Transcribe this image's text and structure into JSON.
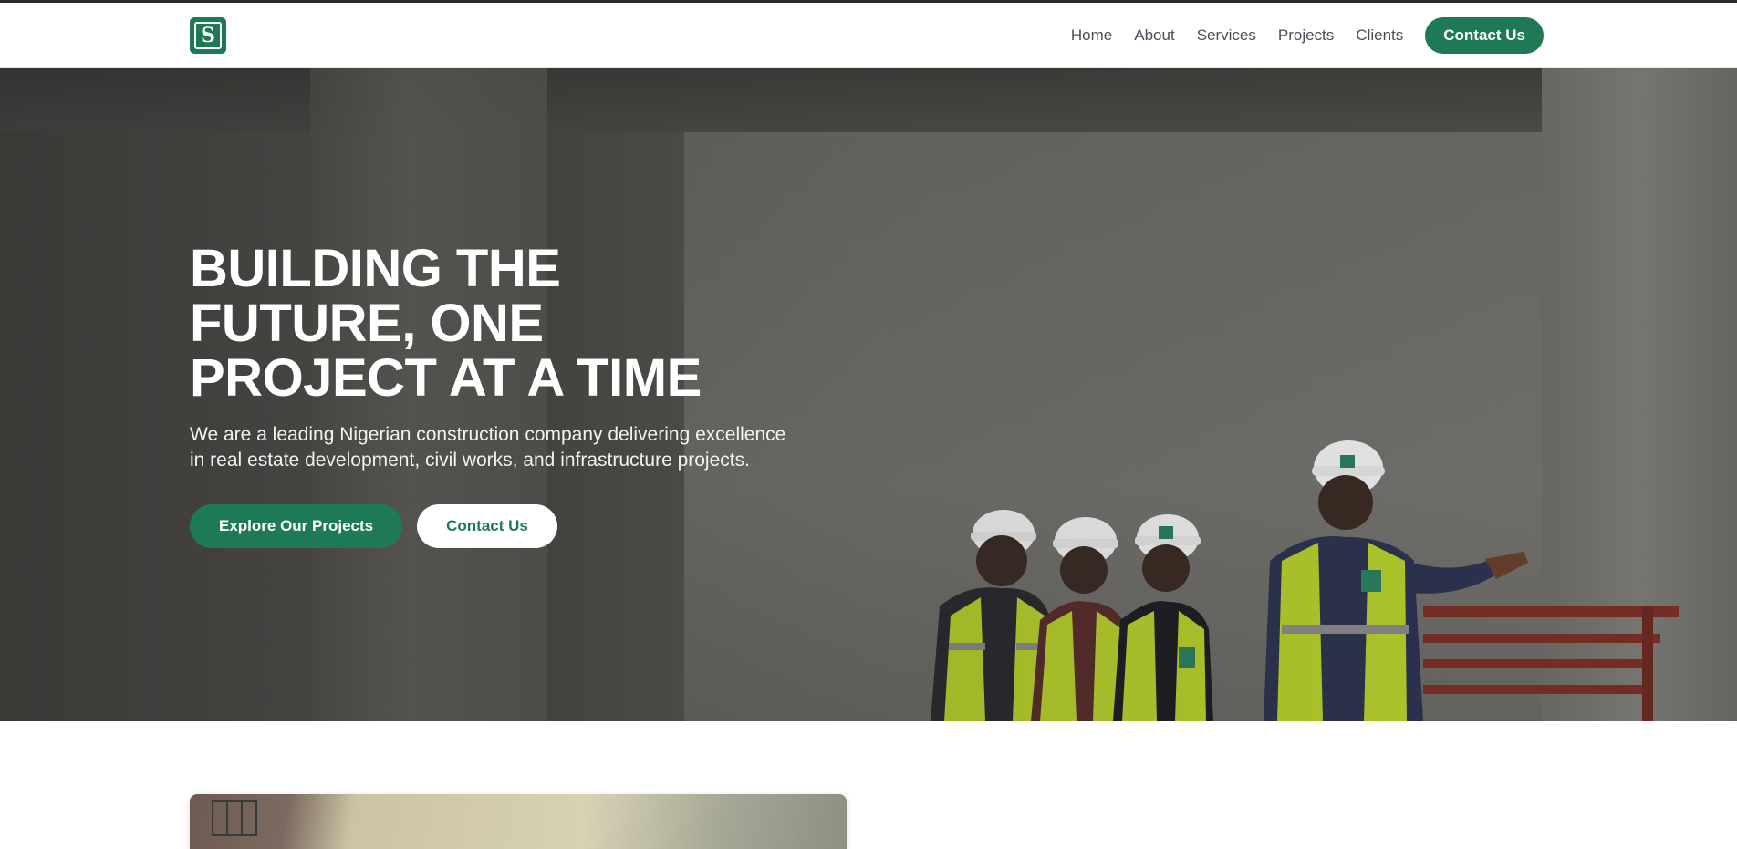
{
  "brand": {
    "logo_letter": "S",
    "accent_color": "#1e7a55"
  },
  "nav": {
    "items": [
      {
        "label": "Home"
      },
      {
        "label": "About"
      },
      {
        "label": "Services"
      },
      {
        "label": "Projects"
      },
      {
        "label": "Clients"
      }
    ],
    "cta_label": "Contact Us"
  },
  "hero": {
    "title": "BUILDING THE\nFUTURE, ONE\nPROJECT AT A TIME",
    "subtitle": "We are a leading Nigerian construction company delivering excellence in real estate development, civil works, and infrastructure projects.",
    "primary_button": "Explore Our Projects",
    "secondary_button": "Contact Us",
    "image_icon": "construction-workers-photo"
  }
}
